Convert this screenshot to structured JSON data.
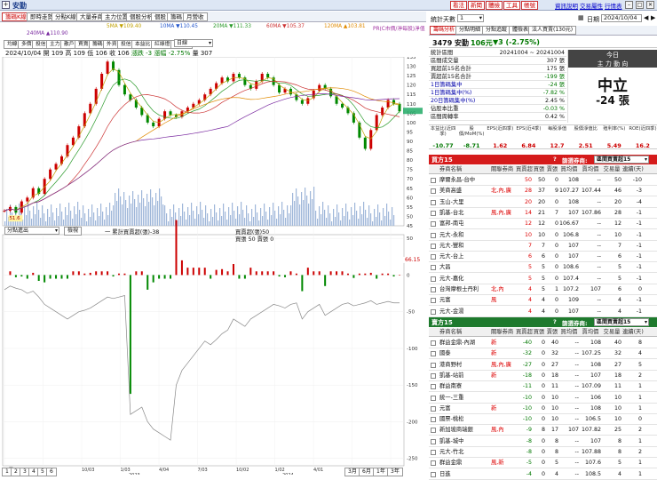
{
  "app": {
    "title": "安勤",
    "header_buttons": [
      "看法",
      "新聞",
      "體檢",
      "工具",
      "帳號"
    ],
    "header_links": [
      "資訊說明",
      "交易屬性",
      "行情表"
    ]
  },
  "top_tabs": [
    "籌碼K線",
    "即時走勢",
    "分點K線",
    "大量券商",
    "主力位置",
    "個股分析",
    "個股",
    "籌碼",
    "月營收"
  ],
  "legend": {
    "ma5": "5MA ▼109.40",
    "ma10": "10MA ▼110.45",
    "ma20": "20MA ▼111.33",
    "ma60": "60MA ▼105.37",
    "ma120": "120MA ▲103.81",
    "pe": "PR(C市價/淨每股)淨值",
    "ma240": "240MA ▲110.90"
  },
  "chart_tabs": [
    "均線",
    "多價",
    "投信",
    "主力",
    "散戶",
    "買賣",
    "籌碼",
    "外資",
    "投信",
    "本益比",
    "紅綠燈",
    "分價量"
  ],
  "period_select": "日線",
  "info_line": {
    "date": "2024/10/04",
    "open": "開 109",
    "high": "高 109",
    "low": "低 106",
    "close": "收 106",
    "chg": "漲跌 -3",
    "pct": "漲幅 -2.75%",
    "vol": "量 307"
  },
  "sub_select": "分點進出",
  "sub_btn": "檢視",
  "sub_legend": {
    "a": "一 累計買賣超(張)-38",
    "b": "買賣超(張)50",
    "c": "買張 50 賣張 0"
  },
  "price_annot": {
    "high": "132.5",
    "low": "51.6"
  },
  "sub_last": "66.15",
  "bottom_tabs": [
    "1",
    "2",
    "3",
    "4",
    "5",
    "6"
  ],
  "range_btns": [
    "3月",
    "6月",
    "1年",
    "3年"
  ],
  "chart_data": {
    "type": "line",
    "title": "",
    "price_axis": [
      135,
      130,
      125,
      120,
      115,
      110,
      105,
      100,
      95,
      90,
      85,
      80,
      75,
      70,
      65,
      60,
      55,
      50,
      45
    ],
    "sub_axis": [
      50,
      0,
      -50,
      -100,
      -150,
      -200,
      -250
    ],
    "x_ticks": [
      "3/圓01",
      "7/01",
      "10/03",
      "1/03",
      "4/04",
      "7/03",
      "10/02",
      "1/02",
      "4/01",
      "7/01",
      "10/01"
    ],
    "x_years": [
      "2022",
      "2023",
      "2024"
    ],
    "price_close": [
      53,
      55,
      52,
      58,
      60,
      65,
      62,
      70,
      75,
      78,
      82,
      88,
      92,
      98,
      105,
      110,
      118,
      126,
      132.5,
      128,
      120,
      115,
      112,
      108,
      104,
      100,
      98,
      102,
      106,
      104,
      103,
      106,
      108,
      110,
      112,
      115,
      118,
      121,
      124,
      122,
      126,
      124,
      120,
      118,
      122,
      126,
      124,
      120,
      116,
      118,
      115,
      112,
      110,
      113,
      117,
      120,
      118,
      114,
      110,
      108,
      105,
      100,
      92,
      86,
      96,
      104,
      108,
      112,
      110,
      106
    ],
    "cum_net": [
      -20,
      -15,
      -18,
      -20,
      -25,
      -22,
      -30,
      -40,
      -45,
      -50,
      -55,
      -60,
      -55,
      -50,
      -48,
      -45,
      -40,
      -35,
      -30,
      -32,
      -30,
      -28,
      -190,
      -185,
      -180,
      -200,
      -210,
      -215,
      -220,
      -225,
      -150,
      -130,
      -120,
      -110,
      -100,
      -90,
      -95,
      -88,
      -80,
      -75,
      -60,
      -65,
      -70,
      -60,
      -55,
      -50,
      -45,
      -40,
      -42,
      -45,
      -40,
      -38,
      -60,
      -50,
      -45,
      -40,
      -55,
      -50,
      -45,
      -40,
      -38,
      -42,
      -40,
      -38,
      -35,
      -40,
      -38,
      -36,
      -38,
      -38
    ]
  },
  "stock": {
    "title": "統計天數",
    "days": "1",
    "date_label": "日期",
    "date": "2024/10/04",
    "tabs": [
      "籌碼分析",
      "分點明細",
      "分點追蹤",
      "體檢表",
      "法人買賣(130元)"
    ],
    "code_name": "3479 安勤",
    "price": "106元",
    "chg": "▼3 (-2.75%)"
  },
  "stats": {
    "rows": [
      [
        "統計區間",
        "20241004 ~ 20241004"
      ],
      [
        "區間成交量",
        "307 張"
      ],
      [
        "買超前15名合計",
        "175 張"
      ],
      [
        "賣超前15名合計",
        "-199 張"
      ],
      [
        "1日籌碼集中",
        "-24 張"
      ],
      [
        "1日籌碼集中(%)",
        "-7.82 %"
      ],
      [
        "20日籌碼集中(%)",
        "2.45 %"
      ],
      [
        "佔股本比重",
        "-0.03 %"
      ],
      [
        "區間周轉率",
        "0.42 %"
      ]
    ],
    "main_title": "今日",
    "main_sub": "主 力 動 向",
    "main_word": "中立",
    "main_val": "-24 張"
  },
  "metrics": {
    "heads": [
      "本益比(近四季)",
      "股價/MoM(%)",
      "EPS(近四季)",
      "EPS(近4季)",
      "每股淨值",
      "股價淨值比",
      "殖利率(%)",
      "ROE(近四季)"
    ],
    "vals": [
      "-10.77",
      "-8.71",
      "1.62",
      "6.84",
      "12.7",
      "2.51",
      "5.49",
      "16.2"
    ]
  },
  "buy": {
    "title": "買方15",
    "filter_label": "篩選券商:",
    "filter": "區間買賣超15",
    "heads": [
      "券商名稱",
      "關聯券商",
      "買賣超",
      "買張",
      "賣張",
      "買均價",
      "賣均價",
      "交易量",
      "連續(天)"
    ],
    "rows": [
      [
        "摩爾永昌-台中",
        "",
        "50",
        "50",
        "0",
        "108",
        "--",
        "50",
        "-10"
      ],
      [
        "美商高盛",
        "北,內,廣",
        "28",
        "37",
        "9",
        "107.27",
        "107.44",
        "46",
        "-3"
      ],
      [
        "玉山-大里",
        "",
        "20",
        "20",
        "0",
        "108",
        "--",
        "20",
        "-4"
      ],
      [
        "凱基-台北",
        "風,內,廣",
        "14",
        "21",
        "7",
        "107",
        "107.86",
        "28",
        "-1"
      ],
      [
        "富邦-南屯",
        "",
        "12",
        "12",
        "0",
        "106.67",
        "--",
        "12",
        "-1"
      ],
      [
        "元大-永和",
        "",
        "10",
        "10",
        "0",
        "106.8",
        "--",
        "10",
        "-1"
      ],
      [
        "元大-豐和",
        "",
        "7",
        "7",
        "0",
        "107",
        "--",
        "7",
        "-1"
      ],
      [
        "元大-台上",
        "",
        "6",
        "6",
        "0",
        "107",
        "--",
        "6",
        "-1"
      ],
      [
        "大昌",
        "",
        "5",
        "5",
        "0",
        "108.6",
        "--",
        "5",
        "-1"
      ],
      [
        "元大-嘉化",
        "",
        "5",
        "5",
        "0",
        "107.4",
        "--",
        "5",
        "-1"
      ],
      [
        "台灣摩根士丹利",
        "北,內",
        "4",
        "5",
        "1",
        "107.2",
        "107",
        "6",
        "0"
      ],
      [
        "元富",
        "風",
        "4",
        "4",
        "0",
        "109",
        "--",
        "4",
        "-1"
      ],
      [
        "元大-金湯",
        "",
        "4",
        "4",
        "0",
        "107",
        "--",
        "4",
        "-1"
      ]
    ]
  },
  "sell": {
    "title": "賣方15",
    "filter_label": "篩選券商:",
    "filter": "區間買賣超15",
    "heads": [
      "券商名稱",
      "關聯券商",
      "買賣超",
      "買張",
      "賣張",
      "買均價",
      "賣均價",
      "交易量",
      "連續(天)"
    ],
    "rows": [
      [
        "群益金鼎-內湖",
        "新",
        "-40",
        "0",
        "40",
        "--",
        "108",
        "40",
        "8"
      ],
      [
        "國泰",
        "新",
        "-32",
        "0",
        "32",
        "--",
        "107.25",
        "32",
        "4"
      ],
      [
        "港商野村",
        "風,內,廣",
        "-27",
        "0",
        "27",
        "--",
        "108",
        "27",
        "5"
      ],
      [
        "凱基-站前",
        "新",
        "-18",
        "0",
        "18",
        "--",
        "107",
        "18",
        "2"
      ],
      [
        "群益南寮",
        "",
        "-11",
        "0",
        "11",
        "--",
        "107.09",
        "11",
        "1"
      ],
      [
        "統一-三重",
        "",
        "-10",
        "0",
        "10",
        "--",
        "106",
        "10",
        "1"
      ],
      [
        "元富",
        "新",
        "-10",
        "0",
        "10",
        "--",
        "108",
        "10",
        "1"
      ],
      [
        "國票-桃松",
        "",
        "-10",
        "0",
        "10",
        "--",
        "106.5",
        "10",
        "0"
      ],
      [
        "新加坡商瑞銀",
        "風,內",
        "-9",
        "8",
        "17",
        "107",
        "107.82",
        "25",
        "2"
      ],
      [
        "凱基-城中",
        "",
        "-8",
        "0",
        "8",
        "--",
        "107",
        "8",
        "1"
      ],
      [
        "元大-竹北",
        "",
        "-8",
        "0",
        "8",
        "--",
        "107.88",
        "8",
        "2"
      ],
      [
        "群益金鼎",
        "風,新",
        "-5",
        "0",
        "5",
        "--",
        "107.6",
        "5",
        "1"
      ],
      [
        "日進",
        "",
        "-4",
        "0",
        "4",
        "--",
        "108.5",
        "4",
        "1"
      ]
    ]
  }
}
